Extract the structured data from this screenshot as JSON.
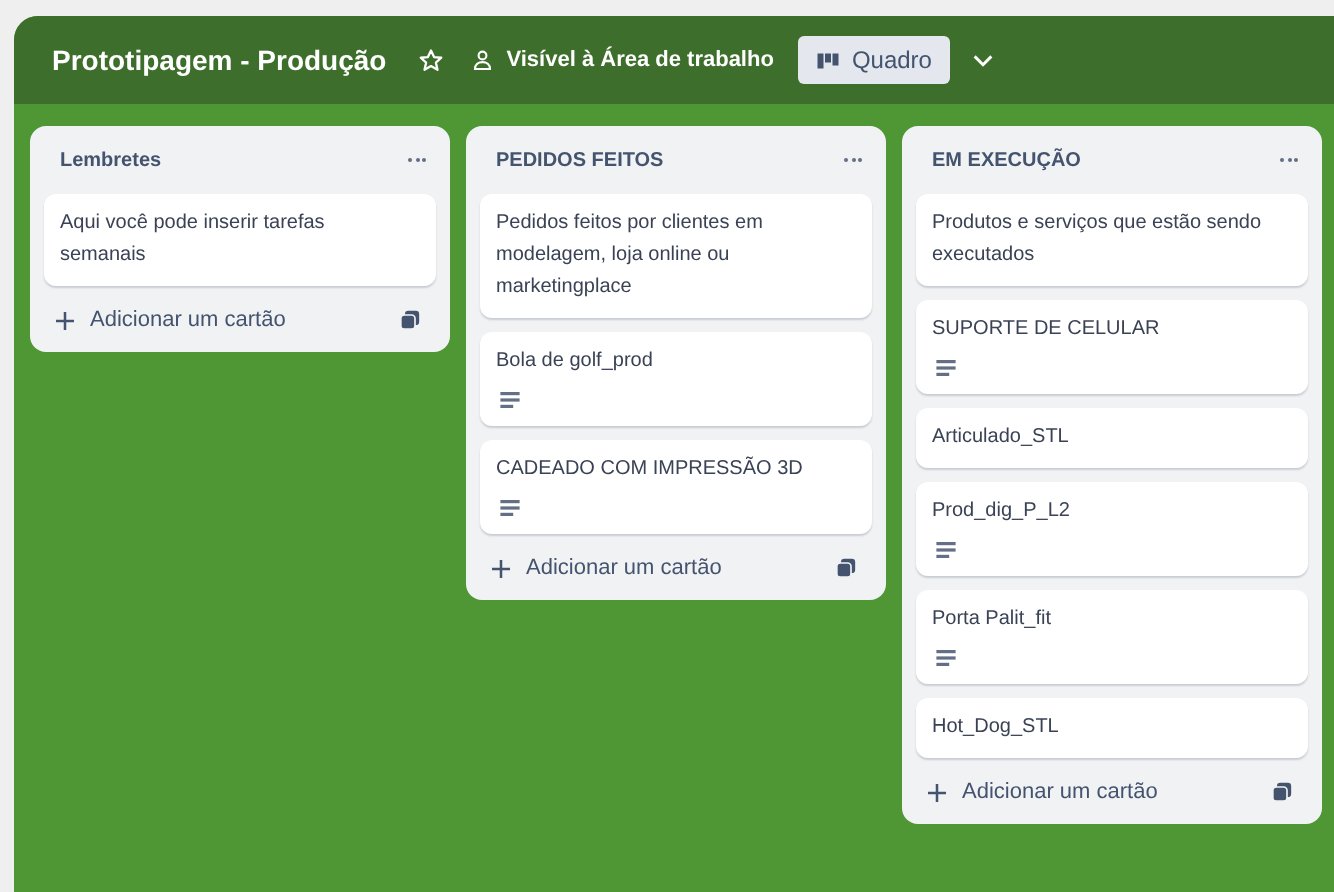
{
  "board": {
    "title": "Prototipagem - Produção",
    "starred": false,
    "visibility": "Visível à Área de trabalho",
    "view_button": "Quadro"
  },
  "lists": [
    {
      "title": "Lembretes",
      "add_label": "Adicionar um cartão",
      "cards": [
        {
          "text": "Aqui você pode inserir tarefas semanais",
          "description": false
        }
      ]
    },
    {
      "title": "PEDIDOS FEITOS",
      "add_label": "Adicionar um cartão",
      "cards": [
        {
          "text": "Pedidos feitos por clientes em modelagem, loja online ou marketingplace",
          "description": false
        },
        {
          "text": "Bola de golf_prod",
          "description": true
        },
        {
          "text": "CADEADO COM IMPRESSÃO 3D",
          "description": true
        }
      ]
    },
    {
      "title": "EM EXECUÇÃO",
      "add_label": "Adicionar um cartão",
      "cards": [
        {
          "text": "Produtos e serviços que estão sendo executados",
          "description": false
        },
        {
          "text": "SUPORTE DE CELULAR",
          "description": true
        },
        {
          "text": "Articulado_STL",
          "description": false
        },
        {
          "text": "Prod_dig_P_L2",
          "description": true
        },
        {
          "text": "Porta Palit_fit",
          "description": true
        },
        {
          "text": "Hot_Dog_STL",
          "description": false
        }
      ]
    }
  ]
}
